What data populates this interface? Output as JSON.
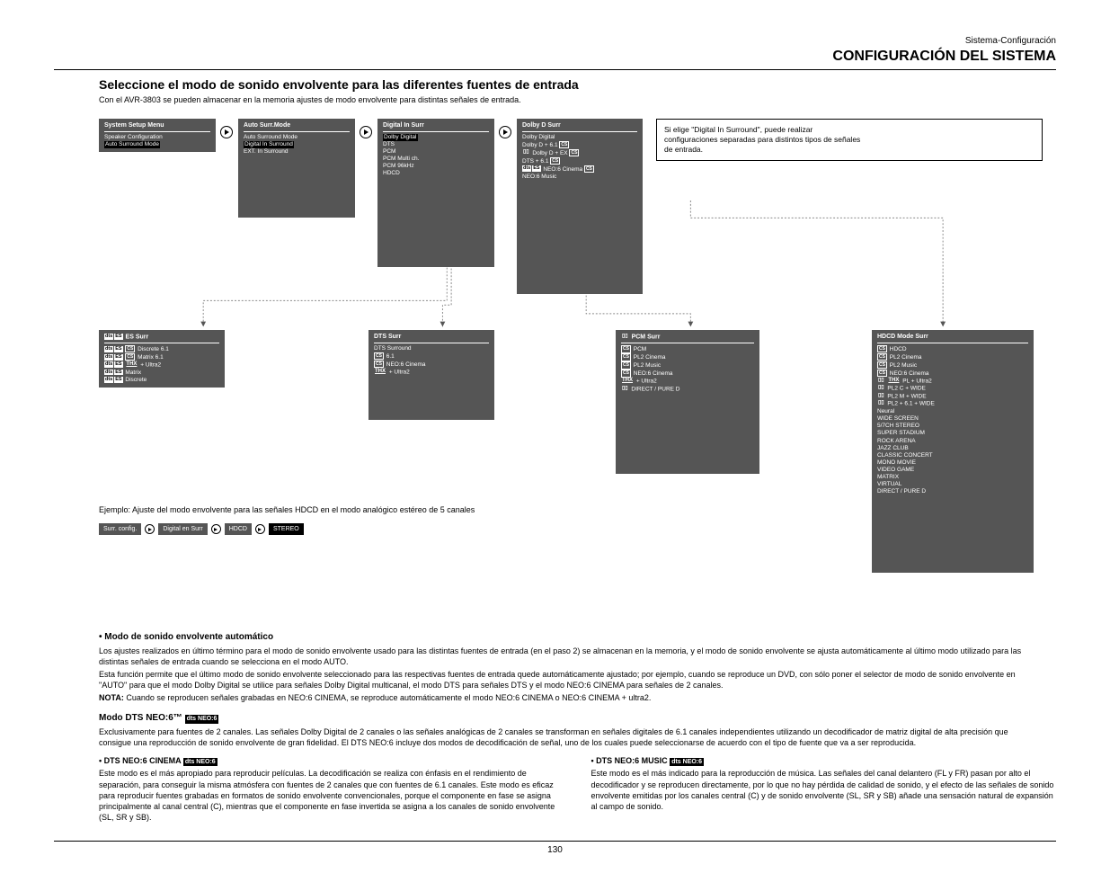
{
  "header": {
    "subtitle": "Sistema-Configuración",
    "title": "CONFIGURACIÓN DEL SISTEMA"
  },
  "section": {
    "title": "Seleccione el modo de sonido envolvente para las diferentes fuentes de entrada",
    "note": "Con el AVR-3803 se pueden almacenar en la memoria ajustes de modo envolvente para distintas señales de entrada."
  },
  "nav": {
    "box1_title": "System Setup Menu",
    "box1_items": [
      "Speaker Configuration",
      "Auto Surround Mode"
    ],
    "box2_title": "Auto Surr.Mode",
    "box2_items": [
      "Auto Surround Mode",
      "Digital In Surround",
      "EXT. In Surround"
    ],
    "box3_title": "Digital In Surr",
    "box3_items": [
      "Dolby Digital",
      "DTS",
      "PCM",
      "PCM Multi ch.",
      "PCM 96kHz",
      "HDCD"
    ],
    "box3_hl": "Dolby Digital",
    "box4_title": "Dolby D Surr",
    "box4_items": [
      {
        "label": "Dolby Digital"
      },
      {
        "label": "Dolby D + 6.1",
        "icon": "cs"
      },
      {
        "label": "Dolby D +",
        "icon": "dd",
        "tail": "EX"
      },
      {
        "label": "DTS + 6.1",
        "icon": "cs"
      },
      {
        "label": "NEO:6 Cinema",
        "icon": "dts",
        "tail": ""
      },
      {
        "label": "NEO:6 Music",
        "icon": "cs"
      }
    ]
  },
  "note_box": {
    "lines": [
      "Si elige \"Digital In Surround\", puede realizar",
      "configuraciones separadas para distintos tipos de señales",
      "de entrada."
    ]
  },
  "sub_boxes": {
    "es": {
      "title": "ES Surr",
      "items": [
        "Discrete 6.1",
        "Matrix 6.1",
        "+ Ultra2",
        "Matrix",
        "Discrete"
      ]
    },
    "dts": {
      "title": "DTS Surr",
      "items": [
        "DTS Surround",
        "6.1",
        "NEO:6 Cinema",
        "+ Ultra2"
      ]
    },
    "pcm": {
      "title": "PCM Surr",
      "items": [
        "PCM",
        "PL2 Cinema",
        "PL2 Music",
        "NEO:6 Cinema",
        "+ Ultra2",
        "DIRECT / PURE D"
      ]
    },
    "hdcd": {
      "title": "HDCD Mode Surr",
      "items": [
        "HDCD",
        "PL2 Cinema",
        "PL2 Music",
        "NEO:6 Cinema",
        "PL + Ultra2",
        "PL2 C + WIDE",
        "PL2 M + WIDE",
        "PL2 + 6.1 + WIDE",
        "Neural",
        "WIDE SCREEN",
        "5/7CH STEREO",
        "SUPER STADIUM",
        "ROCK ARENA",
        "JAZZ CLUB",
        "CLASSIC CONCERT",
        "MONO MOVIE",
        "VIDEO GAME",
        "MATRIX",
        "VIRTUAL",
        "DIRECT / PURE D"
      ]
    }
  },
  "breadcrumb": {
    "label": "Ejemplo:  Ajuste del modo envolvente para las señales HDCD en el modo analógico estéreo de 5 canales",
    "chips": [
      "Surr. config.",
      "Digital en Surr",
      "HDCD",
      "STEREO"
    ]
  },
  "body": {
    "mode_title": "• Modo de sonido envolvente automático",
    "mode_p1": "Los ajustes realizados en último término para el modo de sonido envolvente usado para las distintas fuentes de entrada (en el paso 2) se almacenan en la memoria, y el modo de sonido envolvente se ajusta automáticamente al último modo utilizado para las distintas señales de entrada cuando se selecciona en el modo AUTO.",
    "mode_p2": "Esta función permite que el último modo de sonido envolvente seleccionado para las respectivas fuentes de entrada quede automáticamente ajustado; por ejemplo, cuando se reproduce un DVD, con sólo poner el selector de modo de sonido envolvente en \"AUTO\" para que el modo Dolby Digital se utilice para señales Dolby Digital multicanal, el modo DTS para señales DTS y el modo NEO:6 CINEMA para señales de 2 canales.",
    "note_label": "NOTA:",
    "note_text": "Cuando se reproducen señales grabadas en NEO:6 CINEMA, se reproduce automáticamente el modo NEO:6 CINEMA o NEO:6 CINEMA + ultra2.",
    "col1_title": "• DTS NEO:6 CINEMA",
    "col1_text": "Este modo es el más apropiado para reproducir películas. La decodificación se realiza con énfasis en el rendimiento de separación, para conseguir la misma atmósfera con fuentes de 2 canales que con fuentes de 6.1 canales. Este modo es eficaz para reproducir fuentes grabadas en formatos de sonido envolvente convencionales, porque el componente en fase se asigna principalmente al canal central (C), mientras que el componente en fase invertida se asigna a los canales de sonido envolvente (SL, SR y SB).",
    "col2_title": "• DTS NEO:6 MUSIC",
    "col2_text": "Este modo es el más indicado para la reproducción de música. Las señales del canal delantero (FL y FR) pasan por alto el decodificador y se reproducen directamente, por lo que no hay pérdida de calidad de sonido, y el efecto de las señales de sonido envolvente emitidas por los canales central (C) y de sonido envolvente (SL, SR y SB) añade una sensación natural de expansión al campo de sonido.",
    "neo_title": "Modo DTS NEO:6™",
    "neo_text": "Exclusivamente para fuentes de 2 canales. Las señales Dolby Digital de 2 canales o las señales analógicas de 2 canales se transforman en señales digitales de 6.1 canales independientes utilizando un decodificador de matriz digital de alta precisión que consigue una reproducción de sonido envolvente de gran fidelidad. El DTS NEO:6 incluye dos modos de decodificación de señal, uno de los cuales puede seleccionarse de acuerdo con el tipo de fuente que va a ser reproducida."
  },
  "footer": {
    "page": "130"
  }
}
